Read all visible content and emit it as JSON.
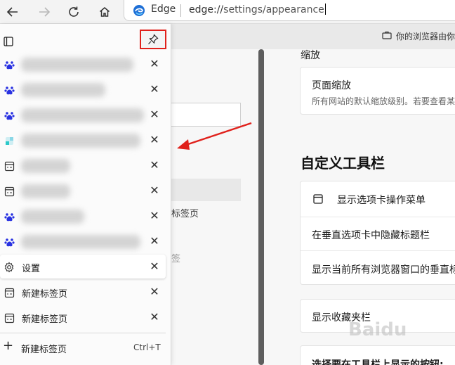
{
  "browser": {
    "address_brand": "Edge",
    "address_url_scheme": "edge://",
    "address_url_path": "settings/appearance"
  },
  "window": {
    "notice_text": "你的浏览器由你"
  },
  "settings_page": {
    "left_fragment_1": "标签页",
    "left_fragment_2": "签",
    "zoom_section": "缩放",
    "zoom_title": "页面缩放",
    "zoom_desc": "所有网站的默认缩放级别。若要查看某",
    "toolbar_section": "自定义工具栏",
    "row_tab_actions": "显示选项卡操作菜单",
    "row_hide_title": "在垂直选项卡中隐藏标题栏",
    "row_all_windows": "显示当前所有浏览器窗口的垂直标",
    "row_favorites_bar": "显示收藏夹栏",
    "row_choose_buttons": "选择要在工具栏上显示的按钮:"
  },
  "vertical_tabs": {
    "tabs": [
      {
        "icon": "baidu-paw-icon",
        "label": "",
        "blur_width": 160
      },
      {
        "icon": "baidu-paw-icon",
        "label": "",
        "blur_width": 120
      },
      {
        "icon": "baidu-paw-icon",
        "label": "",
        "blur_width": 175
      },
      {
        "icon": "colorful-app-icon",
        "label": "",
        "blur_width": 170
      },
      {
        "icon": "window-icon",
        "label": "",
        "blur_width": 70
      },
      {
        "icon": "window-icon",
        "label": "",
        "blur_width": 70
      },
      {
        "icon": "baidu-paw-icon",
        "label": "",
        "blur_width": 90
      },
      {
        "icon": "baidu-paw-icon",
        "label": "",
        "blur_width": 170
      },
      {
        "icon": "gear-icon",
        "label": "设置"
      },
      {
        "icon": "window-icon",
        "label": "新建标签页"
      },
      {
        "icon": "window-icon",
        "label": "新建标签页"
      }
    ],
    "new_tab_label": "新建标签页",
    "new_tab_shortcut": "Ctrl+T"
  },
  "colors": {
    "highlight_red": "#e0211b",
    "baidu_blue": "#2932e1",
    "edge_blue": "#1e6fd6"
  },
  "watermark": "Baidu"
}
